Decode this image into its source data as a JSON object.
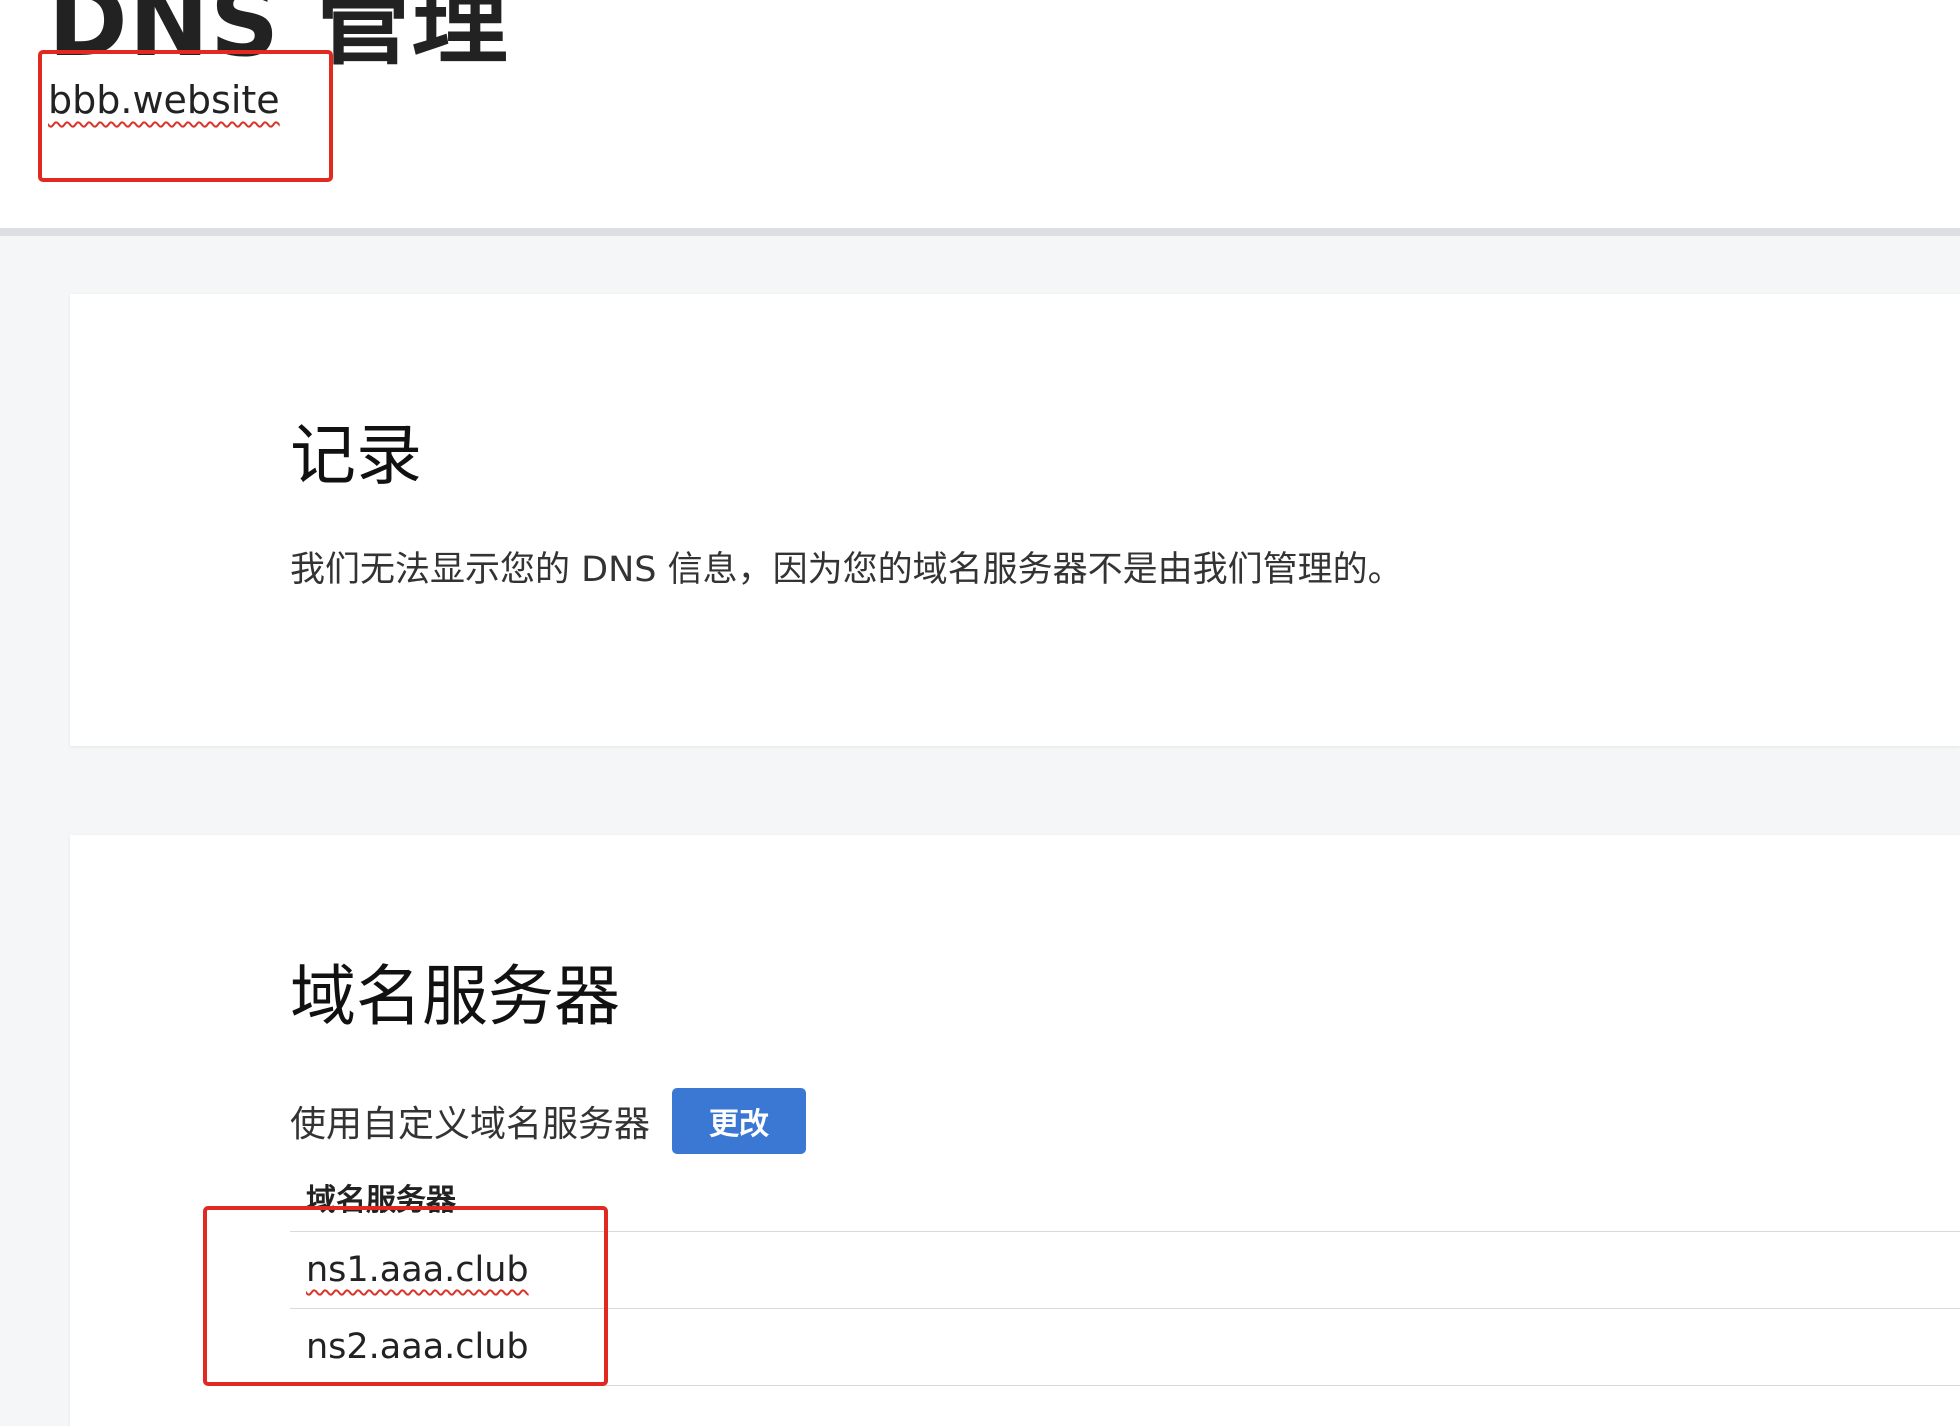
{
  "header": {
    "title": "DNS 管理",
    "domain": "bbb.website"
  },
  "records_card": {
    "title": "记录",
    "message": "我们无法显示您的 DNS 信息，因为您的域名服务器不是由我们管理的。"
  },
  "nameservers_card": {
    "title": "域名服务器",
    "custom_label": "使用自定义域名服务器",
    "change_button_label": "更改",
    "table_header": "域名服务器",
    "rows": [
      "ns1.aaa.club",
      "ns2.aaa.club"
    ]
  },
  "colors": {
    "accent_button": "#3a78d4",
    "annotation_red": "#e02a20",
    "page_background": "#f5f6f7"
  }
}
